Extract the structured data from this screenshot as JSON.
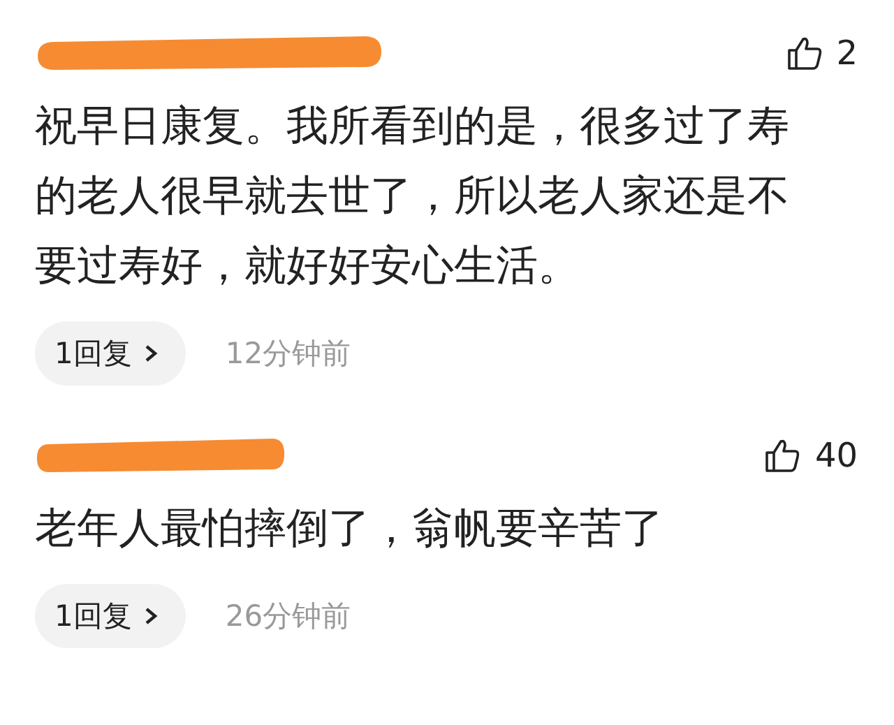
{
  "comments": [
    {
      "likes": "2",
      "text": "祝早日康复。我所看到的是，很多过了寿的老人很早就去世了，所以老人家还是不要过寿好，就好好安心生活。",
      "reply_button": "1回复",
      "time": "12分钟前"
    },
    {
      "likes": "40",
      "text": "老年人最怕摔倒了，翁帆要辛苦了",
      "reply_button": "1回复",
      "time": "26分钟前"
    }
  ]
}
